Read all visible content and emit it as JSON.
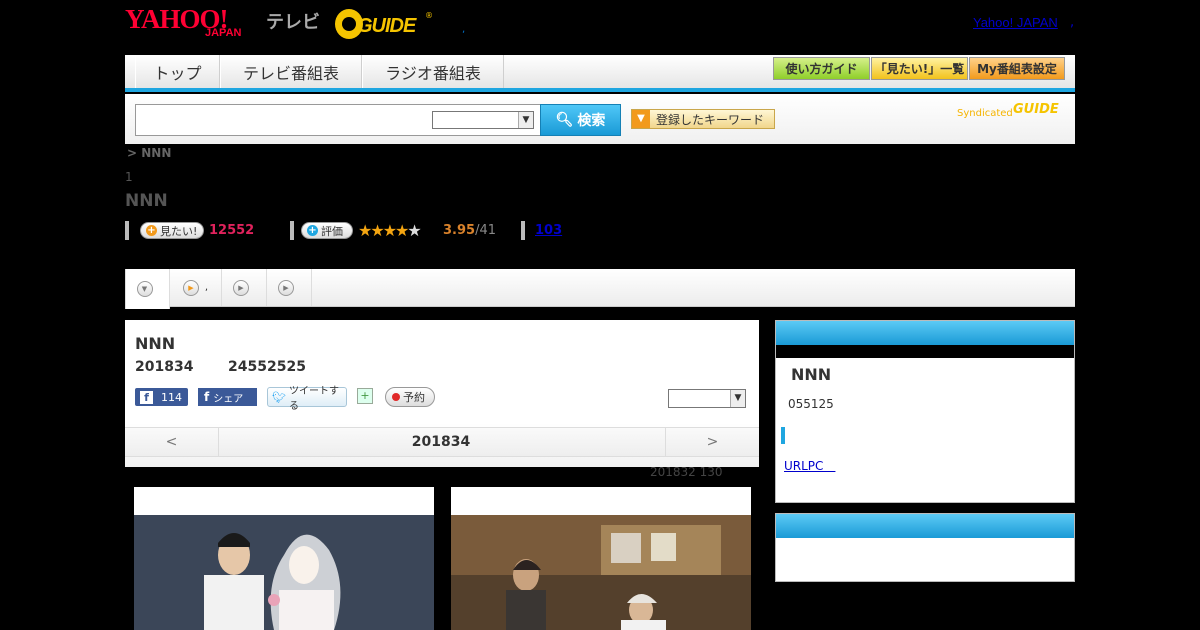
{
  "header": {
    "yahoo_logo": "YAHOO!",
    "japan_label": "JAPAN",
    "tv_label": "テレビ",
    "gguide_logo": "GUIDE",
    "gguide_reg": "®",
    "dot": ",",
    "yahoo_japan_link": "Yahoo! JAPAN",
    "extra_link": ","
  },
  "nav": {
    "tabs": [
      "トップ",
      "テレビ番組表",
      "ラジオ番組表"
    ],
    "buttons": [
      "使い方ガイド",
      "「見たい!」一覧",
      "My番組表設定"
    ]
  },
  "search": {
    "input_value": "",
    "select_value": "",
    "button_label": "検索",
    "keyword_button_label": "登録したキーワード",
    "syndicated_label": "Syndicated",
    "syndicated_logo": "GUIDE"
  },
  "breadcrumb": "> NNN",
  "episode_number": "1",
  "program_title": "NNN",
  "stats": {
    "want_button": "見たい!",
    "want_count": "12552",
    "rate_button": "評価",
    "rating_value": 3.95,
    "rating_display": "3.95",
    "rating_count": "/41",
    "review_count": "103"
  },
  "tabs": [
    {
      "label": ""
    },
    {
      "label": ","
    },
    {
      "label": ""
    },
    {
      "label": ""
    }
  ],
  "episode": {
    "title": "NNN",
    "date": "201834",
    "time": "24552525",
    "like_count": "114",
    "share_label": "シェア",
    "tweet_label": "ツイートする",
    "reserve_label": "予約",
    "select_value": "",
    "pager_prev": "<",
    "pager_date": "201834",
    "pager_next": ">",
    "updated": "201832  130"
  },
  "sidebar": {
    "title": "NNN",
    "subtitle": "055125",
    "link": "URLPC　"
  },
  "colors": {
    "accent": "#1fa6e0",
    "want_red": "#e0225c",
    "rating_orange": "#d9822b",
    "star": "#f4a511",
    "facebook": "#3b5998"
  }
}
